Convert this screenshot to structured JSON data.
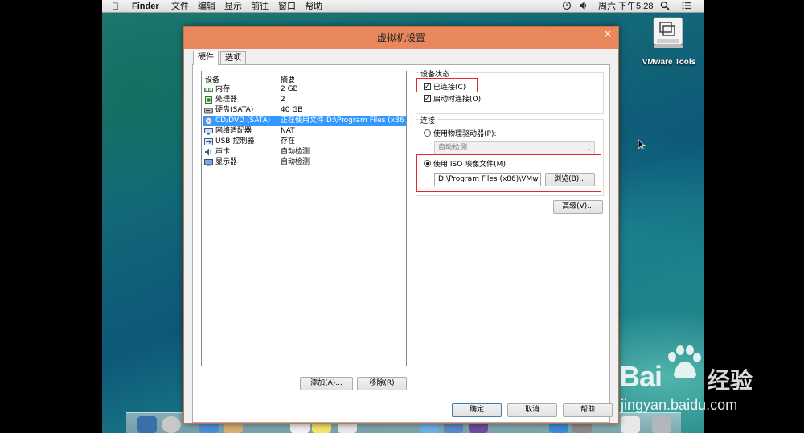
{
  "menubar": {
    "app": "Finder",
    "items": [
      "文件",
      "编辑",
      "显示",
      "前往",
      "窗口",
      "帮助"
    ],
    "clock": "周六 下午5:28"
  },
  "desktop": {
    "icon_label": "VMware Tools"
  },
  "dialog": {
    "title": "虚拟机设置",
    "close": "×",
    "tabs": [
      "硬件",
      "选项"
    ],
    "device_list": {
      "headers": [
        "设备",
        "摘要"
      ],
      "rows": [
        {
          "name": "内存",
          "summary": "2 GB",
          "icon": "memory-icon"
        },
        {
          "name": "处理器",
          "summary": "2",
          "icon": "processor-icon"
        },
        {
          "name": "硬盘(SATA)",
          "summary": "40 GB",
          "icon": "harddisk-icon"
        },
        {
          "name": "CD/DVD (SATA)",
          "summary": "正在使用文件 D:\\Program Files (x86...",
          "icon": "cd-dvd-icon",
          "selected": true
        },
        {
          "name": "网络适配器",
          "summary": "NAT",
          "icon": "network-icon"
        },
        {
          "name": "USB 控制器",
          "summary": "存在",
          "icon": "usb-icon"
        },
        {
          "name": "声卡",
          "summary": "自动检测",
          "icon": "sound-icon"
        },
        {
          "name": "显示器",
          "summary": "自动检测",
          "icon": "display-icon"
        }
      ]
    },
    "add_button": "添加(A)...",
    "remove_button": "移除(R)",
    "device_status": {
      "label": "设备状态",
      "connected": "已连接(C)",
      "connect_at_power_on": "启动时连接(O)"
    },
    "connection": {
      "label": "连接",
      "physical_drive": "使用物理驱动器(P):",
      "physical_drive_value": "自动检测",
      "iso_option": "使用 ISO 映像文件(M):",
      "iso_path": "D:\\Program Files (x86)\\VMw",
      "browse": "浏览(B)..."
    },
    "advanced": "高级(V)...",
    "ok": "确定",
    "cancel": "取消",
    "help": "帮助"
  },
  "watermark": {
    "brand": "Bai",
    "brand_cn": "经验",
    "url": "jingyan.baidu.com"
  },
  "colors": {
    "titlebar": "#e8885c",
    "selection": "#3399ff",
    "highlight_box": "#e8262c"
  }
}
